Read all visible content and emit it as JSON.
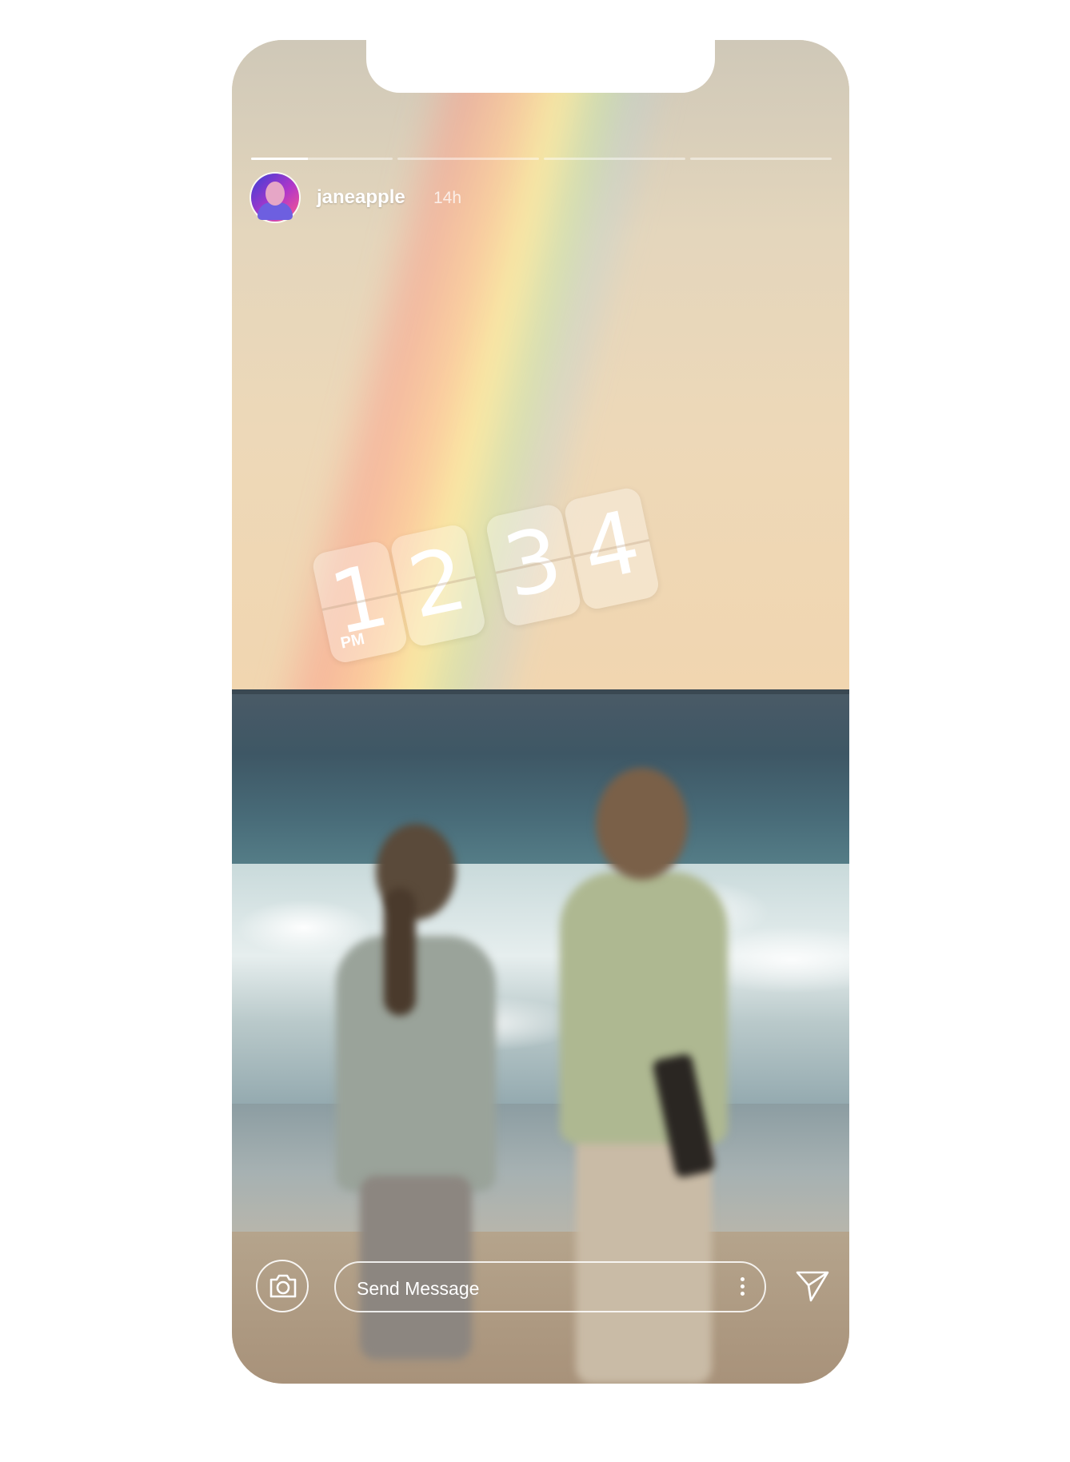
{
  "story": {
    "username": "janeapple",
    "time_ago": "14h",
    "progress": {
      "segments": 4,
      "active_index": 0,
      "active_fraction": 0.4
    }
  },
  "sticker": {
    "type": "flip-clock",
    "ampm": "PM",
    "digits": [
      "1",
      "2",
      "3",
      "4"
    ]
  },
  "reply_bar": {
    "placeholder": "Send Message"
  },
  "icons": {
    "camera": "camera-icon",
    "more": "more-vertical-icon",
    "send": "send-icon"
  },
  "colors": {
    "ui_foreground": "#ffffff",
    "avatar_ring": "#b036c9"
  }
}
